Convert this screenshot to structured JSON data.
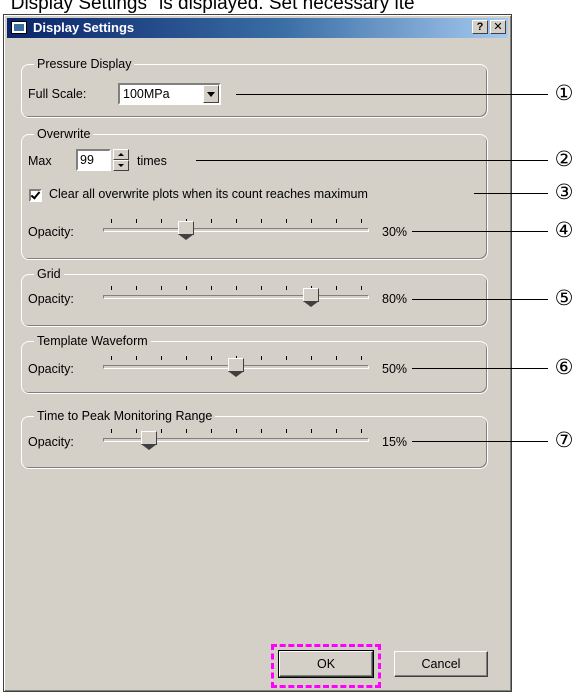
{
  "caption": "\"Display Settings\" is displayed. Set necessary ite",
  "window": {
    "title": "Display Settings",
    "help_label": "?",
    "close_label": "✕"
  },
  "pressure": {
    "group_title": "Pressure Display",
    "full_scale_label": "Full Scale:",
    "full_scale_value": "100MPa"
  },
  "overwrite": {
    "group_title": "Overwrite",
    "max_label": "Max",
    "max_value": "99",
    "times_label": "times",
    "clear_label": "Clear all overwrite plots when its count reaches maximum",
    "clear_checked": true,
    "opacity_label": "Opacity:",
    "opacity_value": 30,
    "opacity_text": "30%"
  },
  "grid": {
    "group_title": "Grid",
    "opacity_label": "Opacity:",
    "opacity_value": 80,
    "opacity_text": "80%"
  },
  "template": {
    "group_title": "Template Waveform",
    "opacity_label": "Opacity:",
    "opacity_value": 50,
    "opacity_text": "50%"
  },
  "ttp": {
    "group_title": "Time to Peak Monitoring Range",
    "opacity_label": "Opacity:",
    "opacity_value": 15,
    "opacity_text": "15%"
  },
  "buttons": {
    "ok_label": "OK",
    "cancel_label": "Cancel"
  },
  "callouts": [
    "①",
    "②",
    "③",
    "④",
    "⑤",
    "⑥",
    "⑦"
  ],
  "colors": {
    "titlebar": "#0a246a",
    "highlight": "#ff00ff",
    "dialog_face": "#d4d0c8"
  }
}
